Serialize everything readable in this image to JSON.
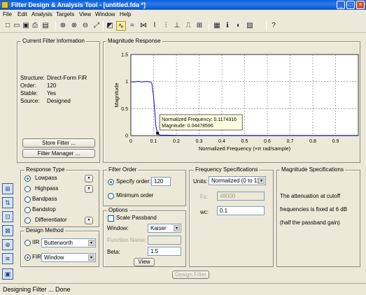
{
  "window": {
    "title": "Filter Design & Analysis Tool - [untitled.fda *]",
    "controls": {
      "minimize": "_",
      "maximize": "□",
      "close": "×"
    }
  },
  "menu": [
    "File",
    "Edit",
    "Analysis",
    "Targets",
    "View",
    "Window",
    "Help"
  ],
  "toolbar": [
    {
      "name": "new-icon",
      "glyph": "□"
    },
    {
      "name": "open-icon",
      "glyph": "▭"
    },
    {
      "name": "save-icon",
      "glyph": "▣"
    },
    {
      "name": "print-icon",
      "glyph": "⎙"
    },
    {
      "name": "print-preview-icon",
      "glyph": "▤"
    },
    {
      "name": "zoom-in-icon",
      "glyph": "⊕"
    },
    {
      "name": "zoom-x-icon",
      "glyph": "⊗"
    },
    {
      "name": "zoom-y-icon",
      "glyph": "⊖"
    },
    {
      "name": "full-view-icon",
      "glyph": "⤢"
    },
    {
      "name": "filter-specs-icon",
      "glyph": "◩"
    },
    {
      "name": "magnitude-response-icon",
      "glyph": "∿"
    },
    {
      "name": "phase-response-icon",
      "glyph": "≈"
    },
    {
      "name": "mag-phase-icon",
      "glyph": "⋈"
    },
    {
      "name": "group-delay-icon",
      "glyph": "⌇"
    },
    {
      "name": "phase-delay-icon",
      "glyph": "⫶"
    },
    {
      "name": "impulse-response-icon",
      "glyph": "⊥"
    },
    {
      "name": "step-response-icon",
      "glyph": "⎍"
    },
    {
      "name": "pole-zero-icon",
      "glyph": "⊞"
    },
    {
      "name": "coefficients-icon",
      "glyph": "▦"
    },
    {
      "name": "filter-info-icon",
      "glyph": "ℹ"
    },
    {
      "name": "round-off-icon",
      "glyph": "◐"
    },
    {
      "name": "noise-icon",
      "glyph": "▨"
    },
    {
      "name": "whats-this-icon",
      "glyph": "?"
    }
  ],
  "current_filter": {
    "title": "Current Filter Information",
    "rows": [
      {
        "label": "Structure:",
        "value": "Direct-Form FIR"
      },
      {
        "label": "Order:",
        "value": "120"
      },
      {
        "label": "Stable:",
        "value": "Yes"
      },
      {
        "label": "Source:",
        "value": "Designed"
      }
    ],
    "store_button": "Store Filter ...",
    "manager_button": "Filter Manager ..."
  },
  "magnitude_panel": {
    "title": "Magnitude Response",
    "chart_data": {
      "type": "line",
      "xlabel": "Normalized Frequency (×π rad/sample)",
      "ylabel": "Magnitude",
      "xlim": [
        0,
        1
      ],
      "ylim": [
        0,
        1.5
      ],
      "x_ticks": [
        "0",
        "0.1",
        "0.2",
        "0.3",
        "0.4",
        "0.5",
        "0.6",
        "0.7",
        "0.8",
        "0.9"
      ],
      "y_ticks": [
        "0",
        "0.5",
        "1",
        "1.5"
      ],
      "grid": true,
      "series": [
        {
          "color": "#0000ff",
          "points": [
            [
              0,
              1.0
            ],
            [
              0.015,
              0.99
            ],
            [
              0.03,
              1.005
            ],
            [
              0.045,
              0.995
            ],
            [
              0.06,
              1.0
            ],
            [
              0.075,
              1.0
            ],
            [
              0.085,
              0.99
            ],
            [
              0.092,
              0.97
            ],
            [
              0.1,
              0.72
            ],
            [
              0.105,
              0.45
            ],
            [
              0.11,
              0.17
            ],
            [
              0.1174316,
              0.04478596
            ],
            [
              0.123,
              0.02
            ],
            [
              0.13,
              0.01
            ],
            [
              0.15,
              0.008
            ],
            [
              0.2,
              0.005
            ],
            [
              0.3,
              0.004
            ],
            [
              0.5,
              0.003
            ],
            [
              0.7,
              0.003
            ],
            [
              1.0,
              0.002
            ]
          ]
        }
      ],
      "datatip": {
        "x": 0.1174316,
        "y": 0.04478596,
        "line1": "Normalized Frequency: 0.1174316",
        "line2": "Magnitude: 0.04478596"
      }
    }
  },
  "response_type": {
    "title": "Response Type",
    "options": [
      {
        "label": "Lowpass",
        "selected": true,
        "has_dropdown": true
      },
      {
        "label": "Highpass",
        "selected": false,
        "has_dropdown": true
      },
      {
        "label": "Bandpass",
        "selected": false,
        "has_dropdown": false
      },
      {
        "label": "Bandstop",
        "selected": false,
        "has_dropdown": false
      },
      {
        "label": "Differentiator",
        "selected": false,
        "has_dropdown": true
      }
    ]
  },
  "design_method": {
    "title": "Design Method",
    "iir_label": "IIR",
    "iir_value": "Butterworth",
    "fir_label": "FIR",
    "fir_value": "Window"
  },
  "filter_order": {
    "title": "Filter Order",
    "specify_label": "Specify order:",
    "specify_value": "120",
    "minimum_label": "Minimum order"
  },
  "options": {
    "title": "Options",
    "scale_passband": "Scale Passband",
    "window_label": "Window:",
    "window_value": "Kaiser",
    "function_label": "Function Name:",
    "function_value": "",
    "beta_label": "Beta:",
    "beta_value": "1.5",
    "view_button": "View"
  },
  "freq_specs": {
    "title": "Frequency Specifications",
    "units_label": "Units:",
    "units_value": "Normalized (0 to 1)",
    "fs_label": "Fs:",
    "fs_value": "48000",
    "wc_label": "wc:",
    "wc_value": "0.1"
  },
  "mag_specs": {
    "title": "Magnitude Specifications",
    "line1": "The attenuation at cutoff",
    "line2": "frequencies is fixed at 6 dB",
    "line3": "(half the passband gain)"
  },
  "design_button": "Design Filter",
  "status": "Designing Filter ... Done",
  "sidebar_icons": [
    {
      "name": "transform-filter-icon",
      "glyph": "⊞"
    },
    {
      "name": "create-multirate-icon",
      "glyph": "⇅"
    },
    {
      "name": "realize-model-icon",
      "glyph": "⊡"
    },
    {
      "name": "pole-zero-editor-icon",
      "glyph": "⊠"
    },
    {
      "name": "import-filter-icon",
      "glyph": "⊕"
    },
    {
      "name": "set-quantization-icon",
      "glyph": "≋"
    },
    {
      "name": "design-filter-icon",
      "glyph": "▣"
    }
  ]
}
